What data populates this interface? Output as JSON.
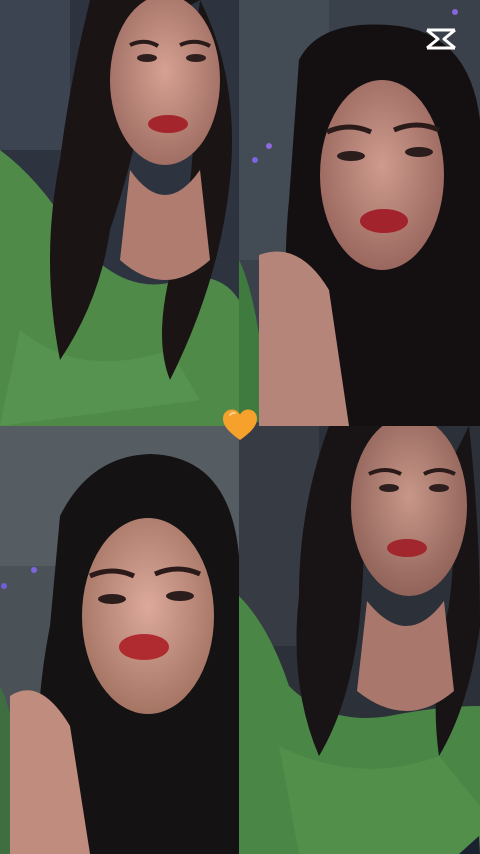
{
  "app": {
    "watermark_icon": "capcut-logo-icon",
    "center_icon": "orange-heart-icon",
    "heart_color": "#f6a12c"
  },
  "photos": [
    {
      "id": "photo-top-left",
      "palette": {
        "bg": "#2d3440",
        "shirt": "#4f8a49",
        "hair": "#1a1414",
        "skin": "#c99384",
        "lips": "#a4262c"
      }
    },
    {
      "id": "photo-top-right",
      "palette": {
        "bg": "#3a414b",
        "shirt": "#3f7a3f",
        "hair": "#141012",
        "skin": "#c38c80",
        "lips": "#a3232d"
      }
    },
    {
      "id": "photo-bottom-left",
      "palette": {
        "bg": "#4a5258",
        "shirt": "#3f6e40",
        "hair": "#151214",
        "skin": "#cf9c8e",
        "lips": "#b02b30"
      }
    },
    {
      "id": "photo-bottom-right",
      "palette": {
        "bg": "#2c3038",
        "shirt": "#4a8646",
        "hair": "#181315",
        "skin": "#bf8b80",
        "lips": "#a2262e"
      }
    }
  ]
}
